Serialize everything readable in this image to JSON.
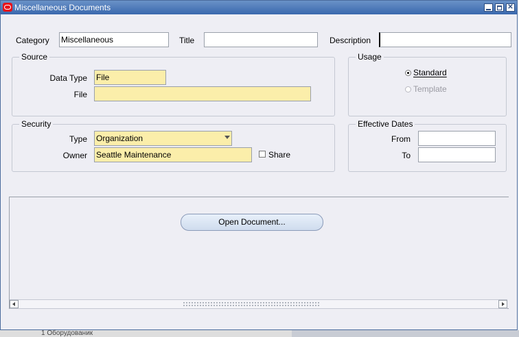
{
  "window": {
    "title": "Miscellaneous Documents",
    "close_glyph": "✕"
  },
  "header_fields": {
    "category_label": "Category",
    "category_value": "Miscellaneous",
    "title_label": "Title",
    "title_value": "",
    "description_label": "Description",
    "description_value": ""
  },
  "source": {
    "group_label": "Source",
    "data_type_label": "Data Type",
    "data_type_value": "File",
    "file_label": "File",
    "file_value": ""
  },
  "usage": {
    "group_label": "Usage",
    "standard_label": "Standard",
    "template_label": "Template",
    "selected": "Standard"
  },
  "security": {
    "group_label": "Security",
    "type_label": "Type",
    "type_value": "Organization",
    "owner_label": "Owner",
    "owner_value": "Seattle Maintenance",
    "share_label": "Share"
  },
  "effective_dates": {
    "group_label": "Effective Dates",
    "from_label": "From",
    "from_value": "",
    "to_label": "To",
    "to_value": ""
  },
  "actions": {
    "open_document_label": "Open Document..."
  },
  "background": {
    "fragment": "1  Оборудованик"
  },
  "colors": {
    "titlebar": "#3a68ad",
    "required_field": "#fbeeaa",
    "window_bg": "#eeeef4"
  }
}
